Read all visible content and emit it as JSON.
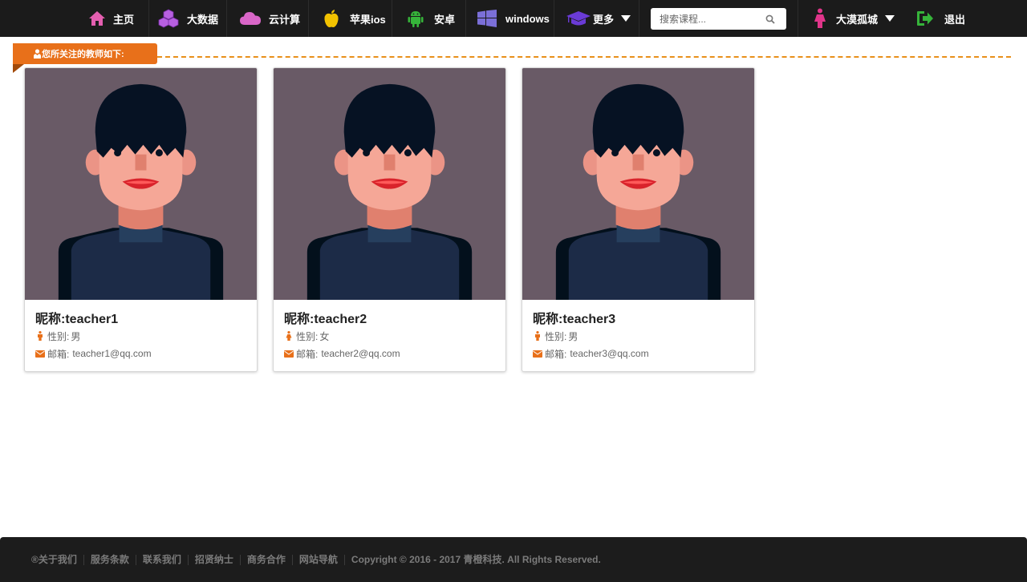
{
  "nav": {
    "items": [
      {
        "label": "主页",
        "icon": "home-icon",
        "color": "#e45fb0"
      },
      {
        "label": "大数据",
        "icon": "cubes-icon",
        "color": "#b760e0"
      },
      {
        "label": "云计算",
        "icon": "cloud-icon",
        "color": "#d966c8"
      },
      {
        "label": "苹果ios",
        "icon": "apple-icon",
        "color": "#f2c200"
      },
      {
        "label": "安卓",
        "icon": "android-icon",
        "color": "#36b43a"
      },
      {
        "label": "windows",
        "icon": "windows-icon",
        "color": "#7b6fd8"
      },
      {
        "label": "更多",
        "icon": "graduation-cap-icon",
        "color": "#6a3bd6"
      }
    ],
    "search_placeholder": "搜索课程...",
    "user_name": "大漠孤城",
    "logout_label": "退出",
    "user_icon_color": "#e0358a",
    "logout_icon_color": "#36b43a"
  },
  "section": {
    "title": "您所关注的教师如下:",
    "accent": "#e8701a"
  },
  "teachers": [
    {
      "nick_label": "昵称:",
      "nick": "teacher1",
      "gender_label": "性别:",
      "gender": "男",
      "email_label": "邮箱:",
      "email": "teacher1@qq.com"
    },
    {
      "nick_label": "昵称:",
      "nick": "teacher2",
      "gender_label": "性别:",
      "gender": "女",
      "email_label": "邮箱:",
      "email": "teacher2@qq.com"
    },
    {
      "nick_label": "昵称:",
      "nick": "teacher3",
      "gender_label": "性别:",
      "gender": "男",
      "email_label": "邮箱:",
      "email": "teacher3@qq.com"
    }
  ],
  "footer": {
    "links": [
      "®关于我们",
      "服务条款",
      "联系我们",
      "招贤纳士",
      "商务合作",
      "网站导航"
    ],
    "copyright": "Copyright © 2016 - 2017 青橙科技. All Rights Reserved."
  }
}
